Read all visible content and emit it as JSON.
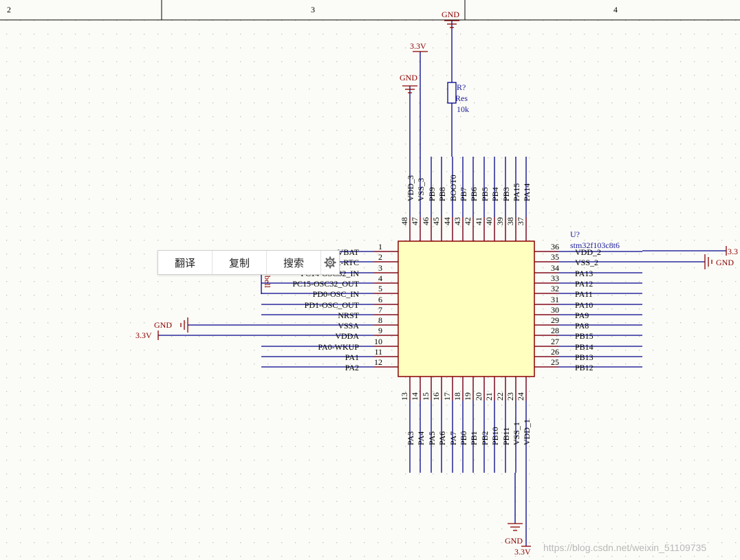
{
  "frame": {
    "zones": [
      "2",
      "3",
      "4"
    ]
  },
  "component": {
    "designator": "U?",
    "comment": "stm32f103c8t6",
    "fill_color": "#ffffc0",
    "outline_color": "#8b0000",
    "wire_color": "#00008b",
    "left_pins": [
      {
        "num": "1",
        "name": "VBAT"
      },
      {
        "num": "2",
        "name": "PC13-TAMPER-RTC"
      },
      {
        "num": "3",
        "name": "PC14-OSC32_IN"
      },
      {
        "num": "4",
        "name": "PC15-OSC32_OUT"
      },
      {
        "num": "5",
        "name": "PD0-OSC_IN"
      },
      {
        "num": "6",
        "name": "PD1-OSC_OUT"
      },
      {
        "num": "7",
        "name": "NRST"
      },
      {
        "num": "8",
        "name": "VSSA"
      },
      {
        "num": "9",
        "name": "VDDA"
      },
      {
        "num": "10",
        "name": "PA0-WKUP"
      },
      {
        "num": "11",
        "name": "PA1"
      },
      {
        "num": "12",
        "name": "PA2"
      }
    ],
    "right_pins": [
      {
        "num": "36",
        "name": "VDD_2"
      },
      {
        "num": "35",
        "name": "VSS_2"
      },
      {
        "num": "34",
        "name": "PA13"
      },
      {
        "num": "33",
        "name": "PA12"
      },
      {
        "num": "32",
        "name": "PA11"
      },
      {
        "num": "31",
        "name": "PA10"
      },
      {
        "num": "30",
        "name": "PA9"
      },
      {
        "num": "29",
        "name": "PA8"
      },
      {
        "num": "28",
        "name": "PB15"
      },
      {
        "num": "27",
        "name": "PB14"
      },
      {
        "num": "26",
        "name": "PB13"
      },
      {
        "num": "25",
        "name": "PB12"
      }
    ],
    "top_pins": [
      {
        "num": "48",
        "name": "VDD_3"
      },
      {
        "num": "47",
        "name": "VSS_3"
      },
      {
        "num": "46",
        "name": "PB9"
      },
      {
        "num": "45",
        "name": "PB8"
      },
      {
        "num": "44",
        "name": "BOOT0"
      },
      {
        "num": "43",
        "name": "PB7"
      },
      {
        "num": "42",
        "name": "PB6"
      },
      {
        "num": "41",
        "name": "PB5"
      },
      {
        "num": "40",
        "name": "PB4"
      },
      {
        "num": "39",
        "name": "PB3"
      },
      {
        "num": "38",
        "name": "PA15"
      },
      {
        "num": "37",
        "name": "PA14"
      }
    ],
    "bottom_pins": [
      {
        "num": "13",
        "name": "PA3"
      },
      {
        "num": "14",
        "name": "PA4"
      },
      {
        "num": "15",
        "name": "PA5"
      },
      {
        "num": "16",
        "name": "PA6"
      },
      {
        "num": "17",
        "name": "PA7"
      },
      {
        "num": "18",
        "name": "PB0"
      },
      {
        "num": "19",
        "name": "PB1"
      },
      {
        "num": "20",
        "name": "PB2"
      },
      {
        "num": "21",
        "name": "PB10"
      },
      {
        "num": "22",
        "name": "PB11"
      },
      {
        "num": "23",
        "name": "VSS_1"
      },
      {
        "num": "24",
        "name": "VDD_1"
      }
    ]
  },
  "resistor": {
    "designator": "R?",
    "comment": "Res",
    "value": "10k"
  },
  "power_labels": {
    "gnd_top": "GND",
    "v33_top": "3.3V",
    "gnd_top2": "GND",
    "gnd_left": "GND",
    "v33_left": "3.3V",
    "v33_right": "3.3",
    "gnd_right": "GND",
    "gnd_bottom": "GND",
    "v33_bottom": "3.3V"
  },
  "stray_label": "bell",
  "popup": {
    "translate": "翻译",
    "copy": "复制",
    "search": "搜索",
    "settings_icon": "gear-icon"
  },
  "watermark": "https://blog.csdn.net/weixin_51109735"
}
